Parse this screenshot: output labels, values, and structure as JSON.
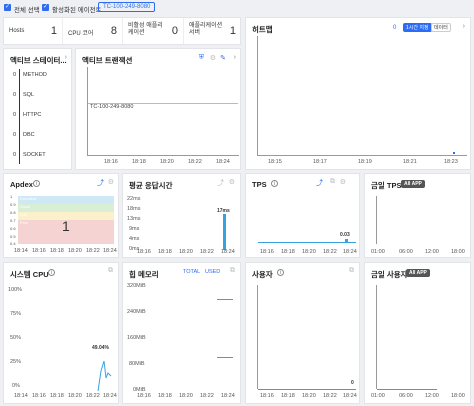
{
  "topbar": {
    "select_all": "전체 선택",
    "active_agents": "활성화된 에이전트",
    "agent_tag": "TC-100-249-8080"
  },
  "stats": [
    {
      "label": "Hosts",
      "value": "1"
    },
    {
      "label": "CPU 코어",
      "value": "8"
    },
    {
      "label": "비활성 애플리케이션",
      "value": "0"
    },
    {
      "label": "애플리케이션 서버",
      "value": "1"
    }
  ],
  "active_status": {
    "title": "액티브 스테이터...",
    "rows": [
      {
        "value": "0",
        "label": "METHOD"
      },
      {
        "value": "0",
        "label": "SQL"
      },
      {
        "value": "0",
        "label": "HTTPC"
      },
      {
        "value": "0",
        "label": "DBC"
      },
      {
        "value": "0",
        "label": "SOCKET"
      }
    ]
  },
  "active_tx": {
    "title": "액티브 트랜잭션",
    "agent": "TC-100-249-8080",
    "xticks": [
      "18:16",
      "18:18",
      "18:20",
      "18:22",
      "18:24"
    ]
  },
  "heatmap": {
    "title": "히트맵",
    "count": "0",
    "btn_range": "1시간 지정",
    "btn_data": "데이터",
    "xticks": [
      "18:15",
      "18:17",
      "18:19",
      "18:21",
      "18:23"
    ]
  },
  "apdex": {
    "title": "Apdex",
    "value": "1",
    "bands": [
      "Excellent",
      "Good",
      "Fair",
      "Poor"
    ],
    "yticks": [
      "1",
      "0.9",
      "0.8",
      "0.7",
      "0.6",
      "0.5",
      "0.4"
    ],
    "xticks": [
      "18:14",
      "18:16",
      "18:18",
      "18:20",
      "18:22",
      "18:24"
    ],
    "colors": {
      "excellent": "#cfe8f6",
      "good": "#d8efd6",
      "fair": "#fbf0c9",
      "poor": "#f6d3d3"
    }
  },
  "avg_resp": {
    "title": "평균 응답시간",
    "peak_label": "17ms",
    "yticks": [
      "22ms",
      "18ms",
      "13ms",
      "9ms",
      "4ms",
      "0ms"
    ],
    "xticks": [
      "18:16",
      "18:18",
      "18:20",
      "18:22",
      "18:24"
    ]
  },
  "tps": {
    "title": "TPS",
    "peak_label": "0.03",
    "xticks": [
      "18:16",
      "18:18",
      "18:20",
      "18:22",
      "18:24"
    ]
  },
  "today_tps": {
    "title": "금일 TPS",
    "badge": "All APP",
    "xticks": [
      "01:00",
      "06:00",
      "12:00",
      "18:00"
    ]
  },
  "sys_cpu": {
    "title": "시스템 CPU",
    "peak_label": "49.04%",
    "yticks": [
      "100%",
      "75%",
      "50%",
      "25%",
      "0%"
    ],
    "xticks": [
      "18:14",
      "18:16",
      "18:18",
      "18:20",
      "18:22",
      "18:24"
    ]
  },
  "heap": {
    "title": "힙 메모리",
    "legend_total": "TOTAL",
    "legend_used": "USED",
    "yticks": [
      "320MiB",
      "240MiB",
      "160MiB",
      "80MiB",
      "0MiB"
    ],
    "xticks": [
      "18:16",
      "18:18",
      "18:20",
      "18:22",
      "18:24"
    ]
  },
  "users": {
    "title": "사용자",
    "peak_label": "0",
    "xticks": [
      "18:16",
      "18:18",
      "18:20",
      "18:22",
      "18:24"
    ]
  },
  "today_users": {
    "title": "금일 사용자",
    "badge": "All APP",
    "xticks": [
      "01:00",
      "06:00",
      "12:00",
      "18:00"
    ]
  },
  "accent": "#2d6df6",
  "chart_color": "#36a3e0"
}
